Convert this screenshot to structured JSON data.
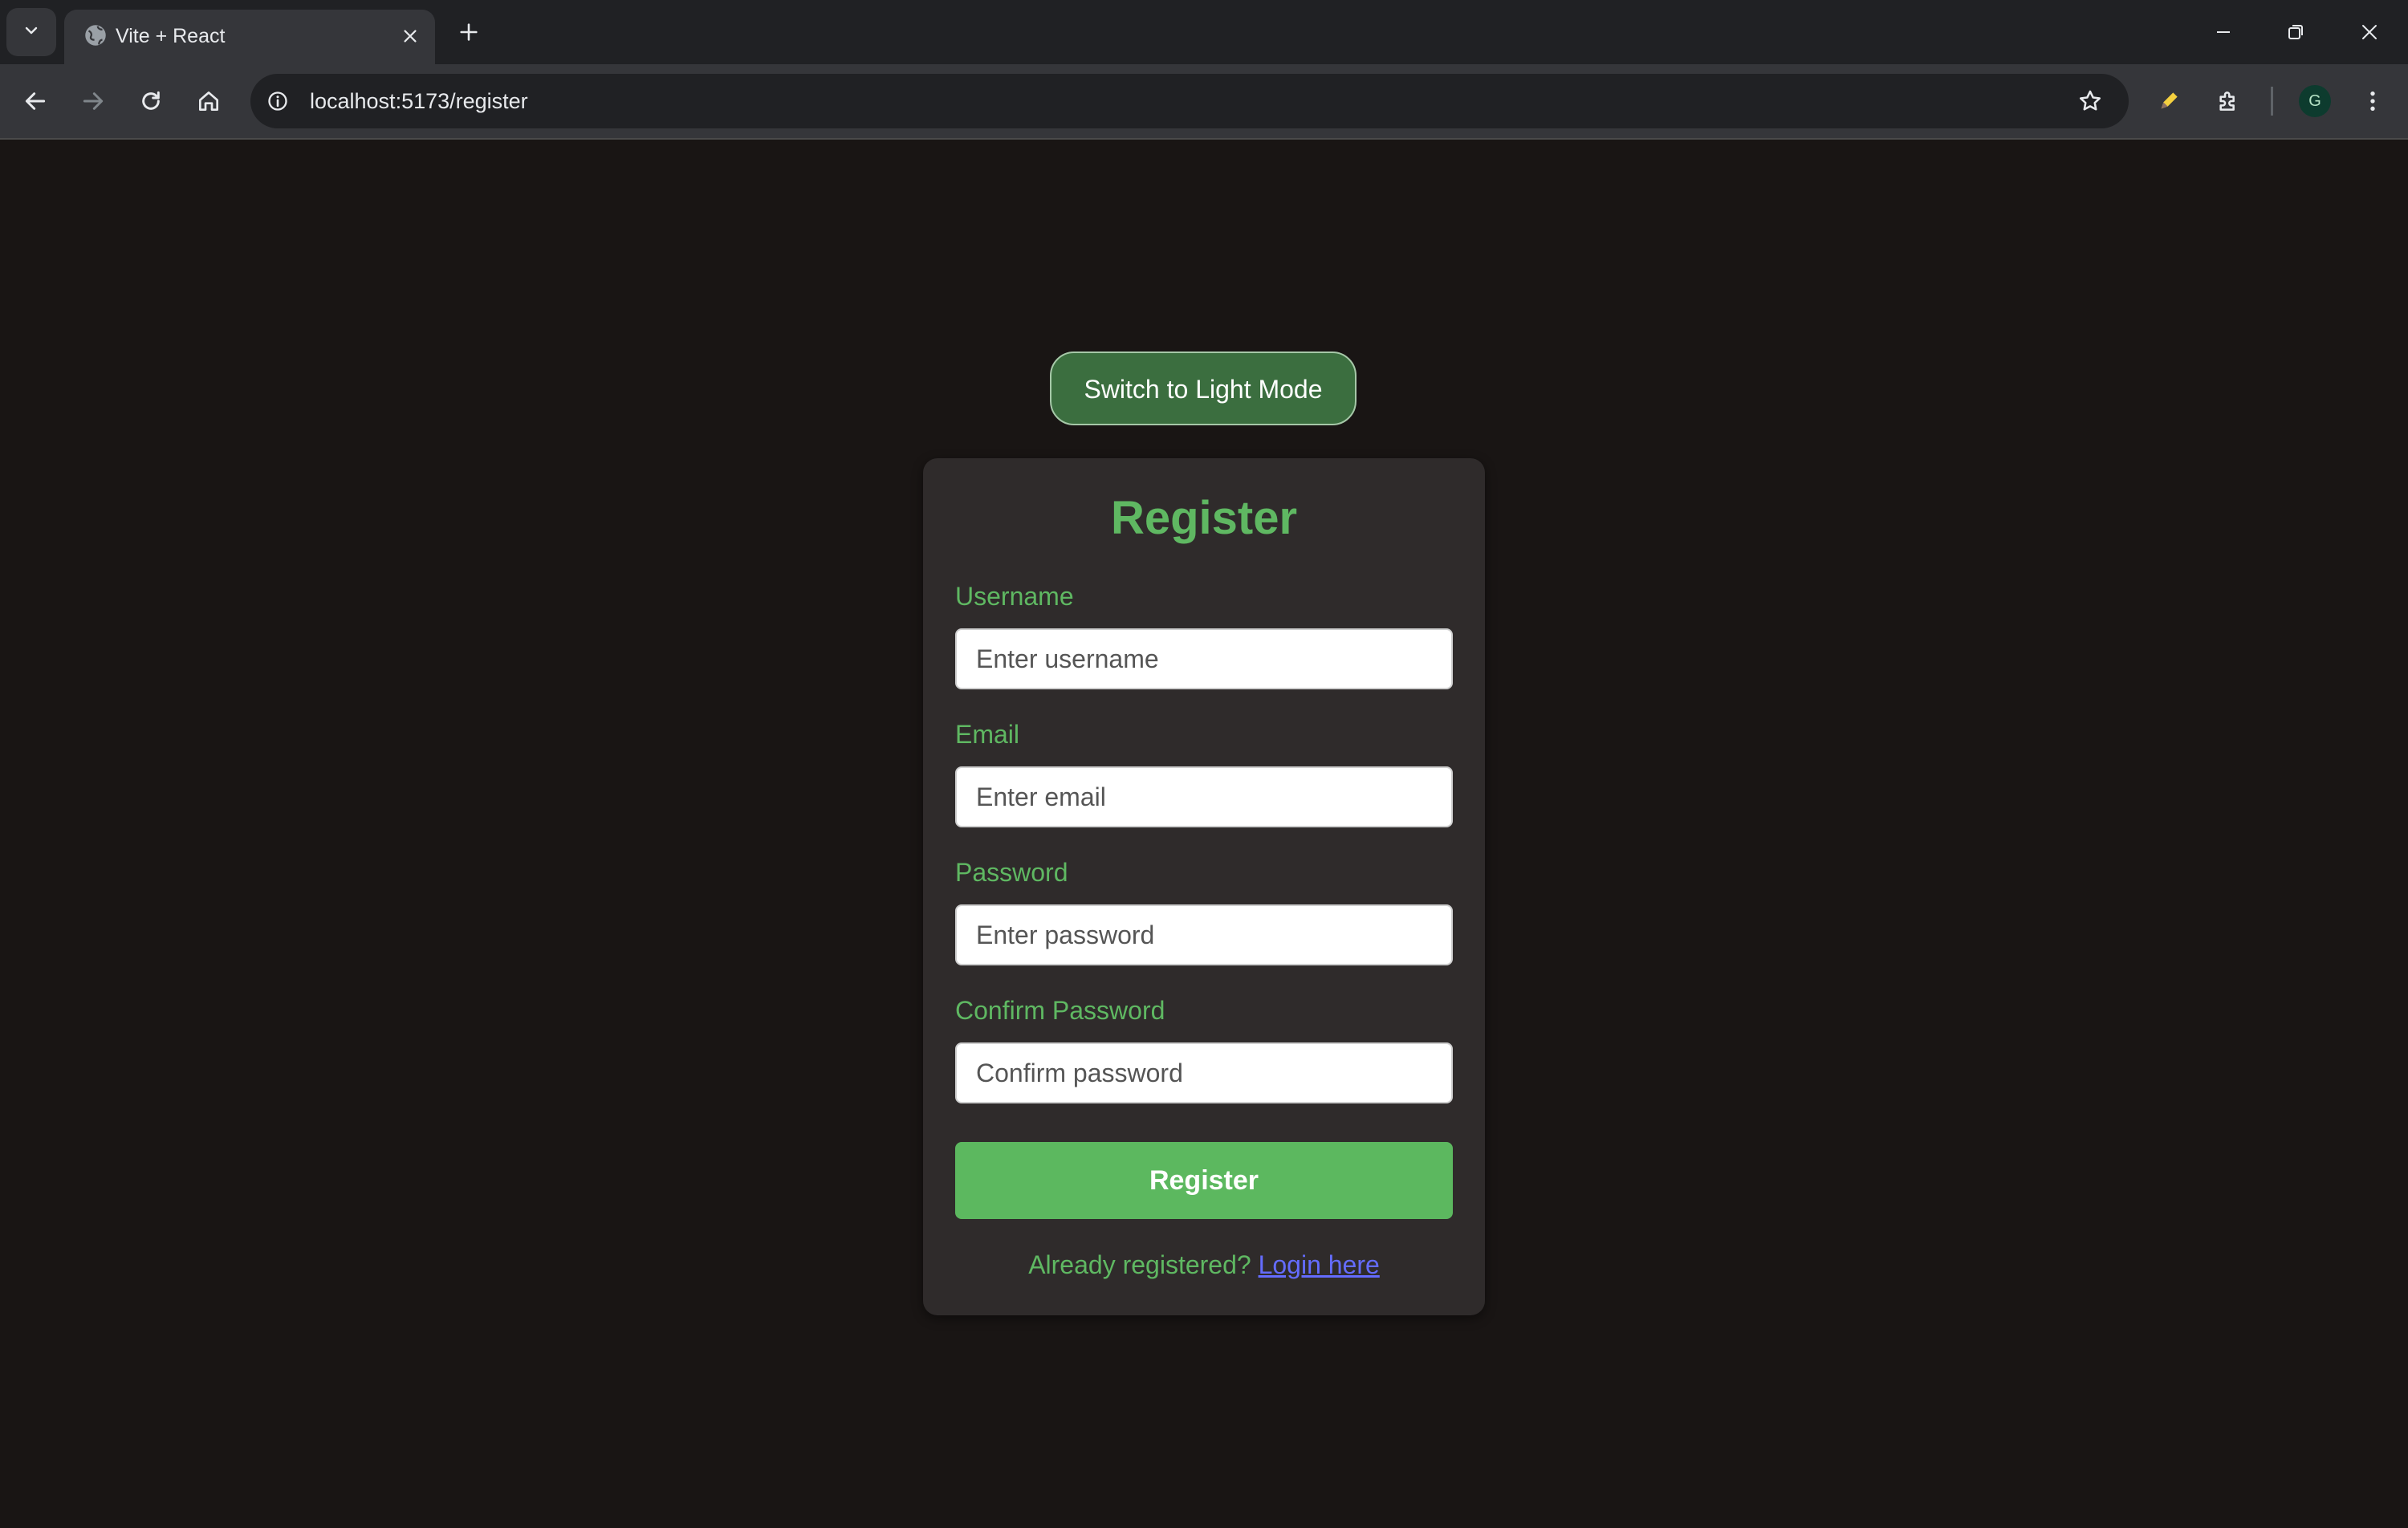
{
  "browser": {
    "tab_title": "Vite + React",
    "url": "localhost:5173/register",
    "profile_initial": "G"
  },
  "page": {
    "theme_toggle_label": "Switch to Light Mode",
    "form": {
      "title": "Register",
      "fields": [
        {
          "label": "Username",
          "placeholder": "Enter username",
          "value": ""
        },
        {
          "label": "Email",
          "placeholder": "Enter email",
          "value": ""
        },
        {
          "label": "Password",
          "placeholder": "Enter password",
          "value": ""
        },
        {
          "label": "Confirm Password",
          "placeholder": "Confirm password",
          "value": ""
        }
      ],
      "submit_label": "Register",
      "footer_text": "Already registered?",
      "footer_link": "Login here"
    }
  },
  "colors": {
    "page_background": "#191514",
    "card_background": "#2f2b2b",
    "accent_green": "#5fb862",
    "toggle_background": "#3b6e3f",
    "link": "#646cff"
  }
}
